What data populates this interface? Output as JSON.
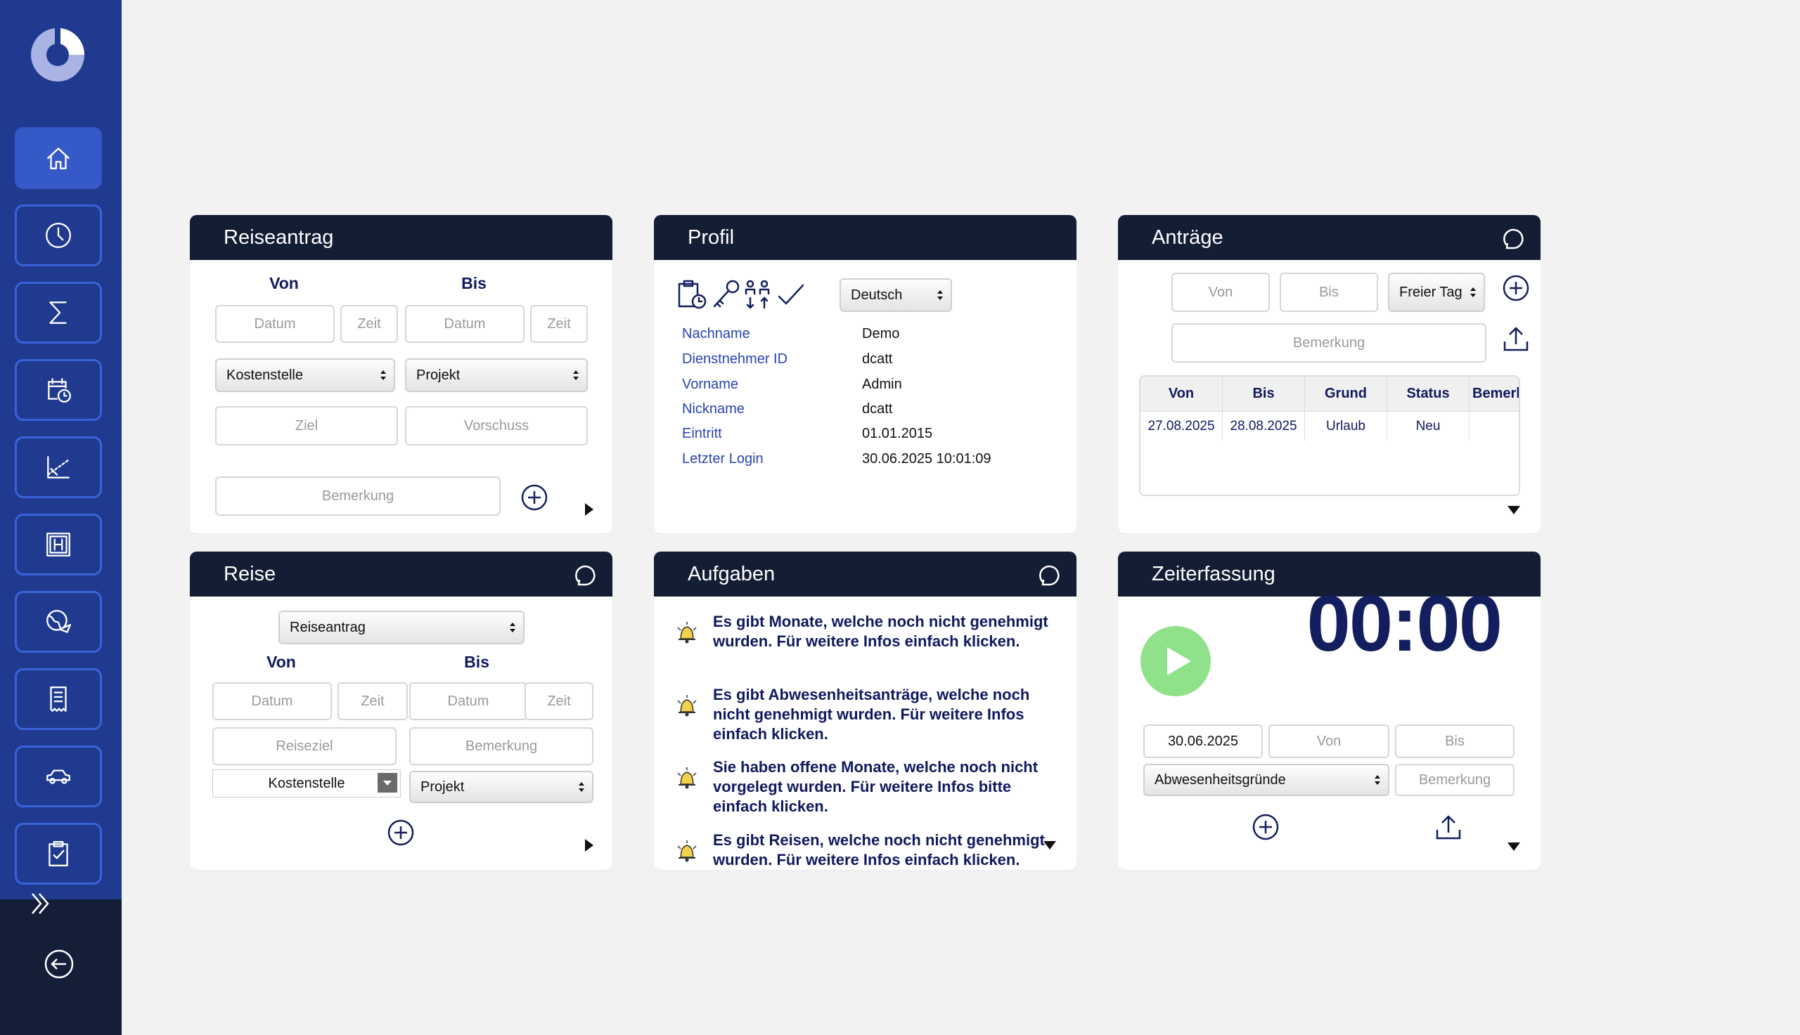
{
  "sidebar": {
    "items": [
      {
        "icon": "home-icon"
      },
      {
        "icon": "clock-icon"
      },
      {
        "icon": "sigma-icon"
      },
      {
        "icon": "calendar-clock-icon"
      },
      {
        "icon": "chart-icon"
      },
      {
        "icon": "hotel-icon"
      },
      {
        "icon": "globe-plane-icon"
      },
      {
        "icon": "receipt-icon"
      },
      {
        "icon": "car-icon"
      },
      {
        "icon": "clipboard-check-icon"
      }
    ]
  },
  "reiseantrag": {
    "title": "Reiseantrag",
    "von": "Von",
    "bis": "Bis",
    "datum_placeholder": "Datum",
    "zeit_placeholder": "Zeit",
    "kostenstelle": "Kostenstelle",
    "projekt": "Projekt",
    "ziel_placeholder": "Ziel",
    "vorschuss_placeholder": "Vorschuss",
    "bemerkung_placeholder": "Bemerkung"
  },
  "profil": {
    "title": "Profil",
    "language": "Deutsch",
    "rows": [
      {
        "key": "Nachname",
        "value": "Demo"
      },
      {
        "key": "Dienstnehmer ID",
        "value": "dcatt"
      },
      {
        "key": "Vorname",
        "value": "Admin"
      },
      {
        "key": "Nickname",
        "value": "dcatt"
      },
      {
        "key": "Eintritt",
        "value": "01.01.2015"
      },
      {
        "key": "Letzter Login",
        "value": "30.06.2025 10:01:09"
      }
    ]
  },
  "antraege": {
    "title": "Anträge",
    "von_placeholder": "Von",
    "bis_placeholder": "Bis",
    "type": "Freier Tag",
    "bemerkung_placeholder": "Bemerkung",
    "columns": [
      "Von",
      "Bis",
      "Grund",
      "Status",
      "Bemerkung"
    ],
    "rows": [
      [
        "27.08.2025",
        "28.08.2025",
        "Urlaub",
        "Neu",
        ""
      ]
    ]
  },
  "reise": {
    "title": "Reise",
    "select": "Reiseantrag",
    "von": "Von",
    "bis": "Bis",
    "datum_placeholder": "Datum",
    "zeit_placeholder": "Zeit",
    "reiseziel_placeholder": "Reiseziel",
    "bemerkung_placeholder": "Bemerkung",
    "kostenstelle": "Kostenstelle",
    "projekt": "Projekt"
  },
  "aufgaben": {
    "title": "Aufgaben",
    "tasks": [
      "Es gibt Monate, welche noch nicht genehmigt wurden. Für weitere Infos einfach klicken.",
      "Es gibt Abwesenheitsanträge, welche noch nicht genehmigt wurden. Für weitere Infos einfach klicken.",
      "Sie haben offene Monate, welche noch nicht vorgelegt wurden. Für weitere Infos bitte einfach klicken.",
      "Es gibt Reisen, welche noch nicht genehmigt wurden. Für weitere Infos einfach klicken."
    ]
  },
  "zeiterfassung": {
    "title": "Zeiterfassung",
    "time": "00:00",
    "date": "30.06.2025",
    "von_placeholder": "Von",
    "bis_placeholder": "Bis",
    "grund": "Abwesenheitsgründe",
    "bemerkung_placeholder": "Bemerkung"
  },
  "colors": {
    "sidebar": "#1f3a8f",
    "card_header": "#131d33",
    "accent_text": "#11195e",
    "play": "#8fe18a"
  }
}
